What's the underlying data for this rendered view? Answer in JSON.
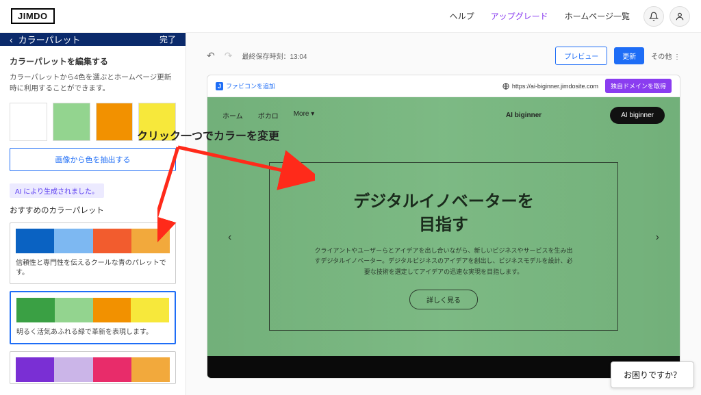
{
  "brand": "JIMDO",
  "nav": {
    "help": "ヘルプ",
    "upgrade": "アップグレード",
    "pages": "ホームページ一覧"
  },
  "sidebar": {
    "title": "カラーパレット",
    "done": "完了",
    "edit_heading": "カラーパレットを編集する",
    "edit_desc": "カラーパレットから4色を選ぶとホームページ更新時に利用することができます。",
    "current_colors": [
      "#3aa044",
      "#93d48f",
      "#f29100",
      "#f7e83b"
    ],
    "extract_btn": "画像から色を抽出する",
    "ai_badge": "AI により生成されました。",
    "rec_title": "おすすめのカラーパレット",
    "palettes": [
      {
        "colors": [
          "#0a62c2",
          "#7db8f2",
          "#f25c2e",
          "#f2a93c"
        ],
        "desc": "信頼性と専門性を伝えるクールな青のパレットです。"
      },
      {
        "colors": [
          "#3aa044",
          "#93d48f",
          "#f29100",
          "#f7e83b"
        ],
        "desc": "明るく活気あふれる緑で革新を表現します。",
        "selected": true
      },
      {
        "colors": [
          "#7a2fd4",
          "#cbb5e8",
          "#e82c6a",
          "#f2a93c"
        ],
        "desc": ""
      }
    ]
  },
  "toolbar": {
    "save_label": "最終保存時刻：13:04",
    "preview": "プレビュー",
    "update": "更新",
    "more": "その他"
  },
  "site": {
    "favicon_add": "ファビコンを追加",
    "url": "https://ai-biginner.jimdosite.com",
    "domain_btn": "独自ドメインを取得",
    "nav_items": [
      "ホーム",
      "ボカロ",
      "More ▾"
    ],
    "brand": "AI biginner",
    "cta": "AI biginner",
    "hero_title_l1": "デジタルイノベーターを",
    "hero_title_l2": "目指す",
    "hero_desc": "クライアントやユーザーらとアイデアを出し合いながら、新しいビジネスやサービスを生み出すデジタルイノベーター。デジタルビジネスのアイデアを創出し、ビジネスモデルを設計、必要な技術を選定してアイデアの迅速な実現を目指します。",
    "hero_cta": "詳しく見る"
  },
  "annotation": "クリック一つでカラーを変更",
  "help_pill": "お困りですか？"
}
